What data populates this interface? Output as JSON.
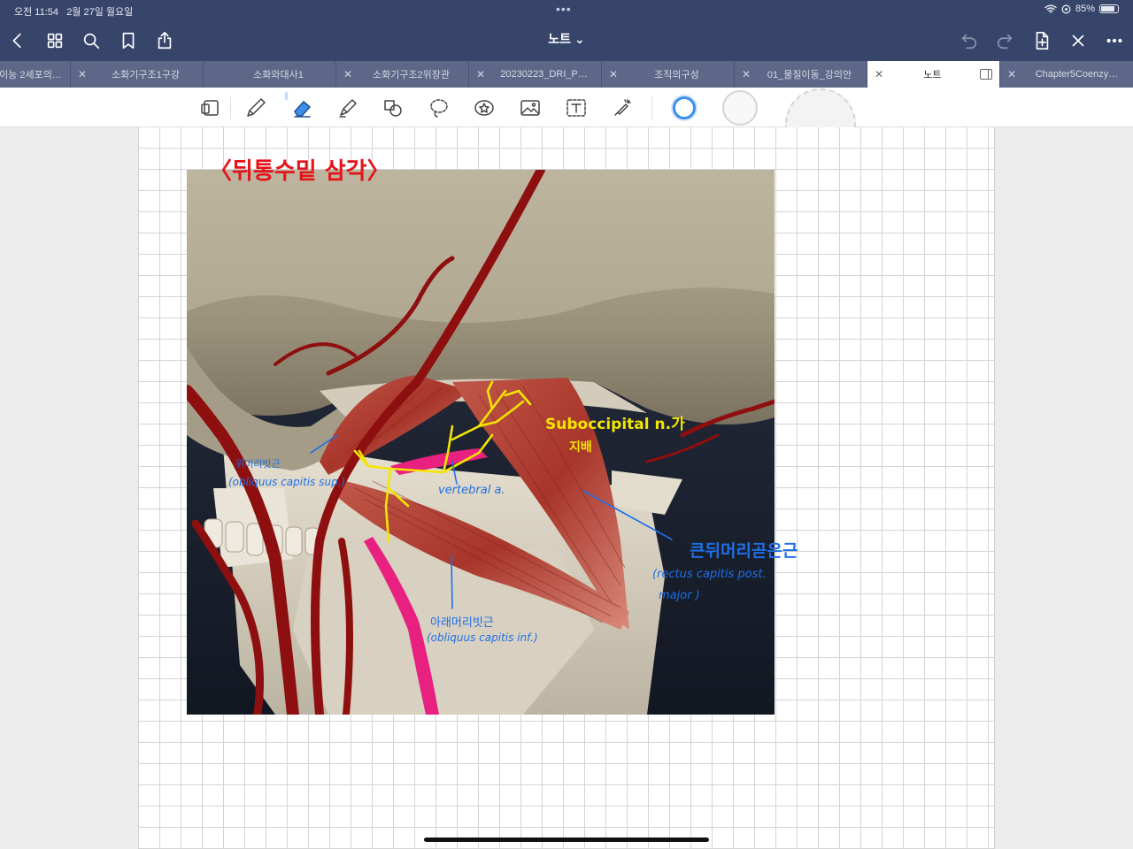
{
  "status": {
    "time": "오전 11:54",
    "date": "2월 27일 월요일",
    "battery": "85%",
    "battery_level": 0.85
  },
  "header": {
    "title": "노트 ⌄",
    "icons": [
      "chevron-left-icon",
      "grid-icon",
      "search-icon",
      "bookmark-icon",
      "share-icon",
      "undo-icon",
      "redo-icon",
      "add-page-icon",
      "close-icon",
      "more-icon"
    ]
  },
  "tabs": [
    {
      "label": "세포의…",
      "active": false
    },
    {
      "label": "소화기구조1구강",
      "active": false
    },
    {
      "label": "소화와대사1",
      "active": false
    },
    {
      "label": "소화기구조2위장관",
      "active": false
    },
    {
      "label": "20230223_DRI_P…",
      "active": false
    },
    {
      "label": "조직의구성",
      "active": false
    },
    {
      "label": "01_물질이동_강의안",
      "active": false
    },
    {
      "label": "노트",
      "active": true
    },
    {
      "label": "Chapter5Coenzy…",
      "active": false
    }
  ],
  "tab_partial_left": "이능 2세포의…",
  "tools": [
    "read-mode-icon",
    "pen-icon",
    "eraser-icon",
    "highlighter-icon",
    "shapes-icon",
    "lasso-icon",
    "sticker-icon",
    "image-icon",
    "text-icon",
    "laser-pointer-icon"
  ],
  "colors": {
    "accent_navy": "#38456b",
    "active_swatch": "#3b8fe8",
    "ink_red": "#e4141a",
    "ink_yellow": "#f4e600",
    "ink_blue": "#1f6fe6"
  },
  "note": {
    "title": "〈뒤통수밑 삼각〉",
    "annotations": {
      "nerve": "Suboccipital n.가",
      "nerve_sub": "지배",
      "oblique_sup_ko": "위머리빗근",
      "oblique_sup_en": "(obliquus capitis sup.)",
      "vertebral": "vertebral a.",
      "rectus_ko": "큰뒤머리곧은근",
      "rectus_en_1": "(rectus capitis post.",
      "rectus_en_2": "major )",
      "oblique_inf_ko": "아래머리빗근",
      "oblique_inf_en": "(obliquus capitis inf.)"
    }
  }
}
